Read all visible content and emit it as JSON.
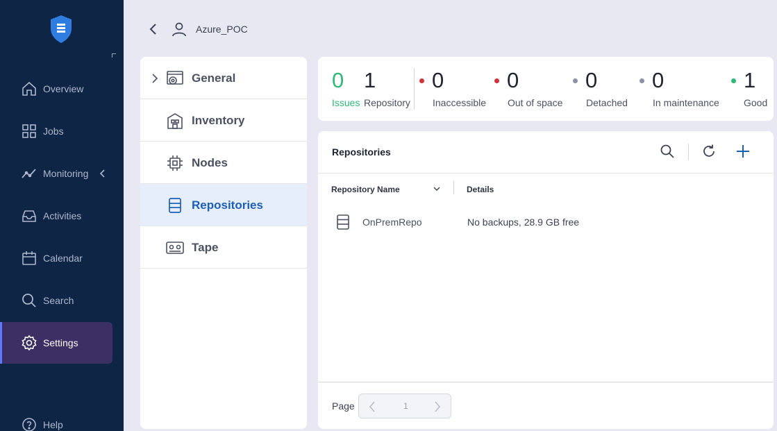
{
  "nav": {
    "items": [
      {
        "label": "Overview",
        "icon": "home-icon"
      },
      {
        "label": "Jobs",
        "icon": "grid-icon"
      },
      {
        "label": "Monitoring",
        "icon": "chart-icon"
      },
      {
        "label": "Activities",
        "icon": "inbox-icon"
      },
      {
        "label": "Calendar",
        "icon": "calendar-icon"
      },
      {
        "label": "Search",
        "icon": "search-icon"
      },
      {
        "label": "Settings",
        "icon": "gear-icon"
      },
      {
        "label": "Help",
        "icon": "help-icon"
      }
    ],
    "active": "Settings"
  },
  "header": {
    "title": "Azure_POC"
  },
  "settings": {
    "items": [
      {
        "label": "General"
      },
      {
        "label": "Inventory"
      },
      {
        "label": "Nodes"
      },
      {
        "label": "Repositories"
      },
      {
        "label": "Tape"
      }
    ],
    "active": "Repositories"
  },
  "stats": {
    "issues": {
      "value": "0",
      "label": "Issues"
    },
    "repository": {
      "value": "1",
      "label": "Repository"
    },
    "inaccessible": {
      "value": "0",
      "label": "Inaccessible"
    },
    "out_of_space": {
      "value": "0",
      "label": "Out of space"
    },
    "detached": {
      "value": "0",
      "label": "Detached"
    },
    "in_maintenance": {
      "value": "0",
      "label": "In maintenance"
    },
    "good": {
      "value": "1",
      "label": "Good"
    }
  },
  "colors": {
    "issues": "#2fb878",
    "red_dot": "#d0343a",
    "gray_dot": "#8a93a6",
    "green_dot": "#2fb878",
    "accent": "#1c5fb8"
  },
  "main": {
    "title": "Repositories",
    "columns": {
      "name": "Repository Name",
      "details": "Details"
    },
    "rows": [
      {
        "name": "OnPremRepo",
        "details": "No backups, 28.9 GB free"
      }
    ],
    "footer": {
      "page_label": "Page",
      "page_number": "1"
    }
  }
}
